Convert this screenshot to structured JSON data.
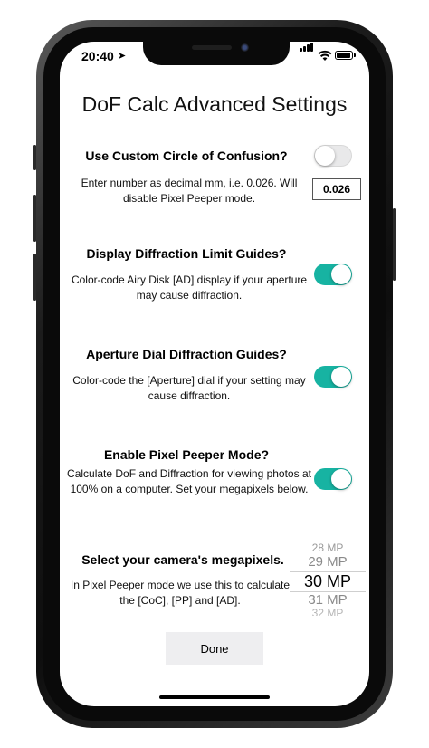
{
  "status_bar": {
    "time": "20:40",
    "location_icon": "location-arrow-icon",
    "signal_icon": "cellular-signal-icon",
    "wifi_icon": "wifi-icon",
    "battery_icon": "battery-icon"
  },
  "page": {
    "title": "DoF Calc Advanced Settings"
  },
  "settings": [
    {
      "id": "coc",
      "title": "Use Custom Circle of Confusion?",
      "description": "Enter number as decimal mm, i.e. 0.026. Will disable Pixel Peeper mode.",
      "enabled": false,
      "input_value": "0.026"
    },
    {
      "id": "diffraction-limit",
      "title": "Display Diffraction Limit Guides?",
      "description": "Color-code Airy Disk [AD] display if your aperture may cause diffraction.",
      "enabled": true
    },
    {
      "id": "aperture-dial",
      "title": "Aperture Dial Diffraction Guides?",
      "description": "Color-code the [Aperture] dial if your setting may cause diffraction.",
      "enabled": true
    },
    {
      "id": "pixel-peeper",
      "title": "Enable Pixel Peeper Mode?",
      "description": "Calculate DoF and Diffraction for viewing photos at 100% on a computer. Set your megapixels below.",
      "enabled": true
    }
  ],
  "megapixels": {
    "title": "Select your camera's megapixels.",
    "description": "In Pixel Peeper mode we use this to calculate the [CoC], [PP] and [AD].",
    "options": [
      "28 MP",
      "29 MP",
      "30 MP",
      "31 MP",
      "32 MP"
    ],
    "selected": "30 MP"
  },
  "done_label": "Done",
  "colors": {
    "toggle_on": "#17b3a2",
    "toggle_off": "#e9e9ea"
  }
}
